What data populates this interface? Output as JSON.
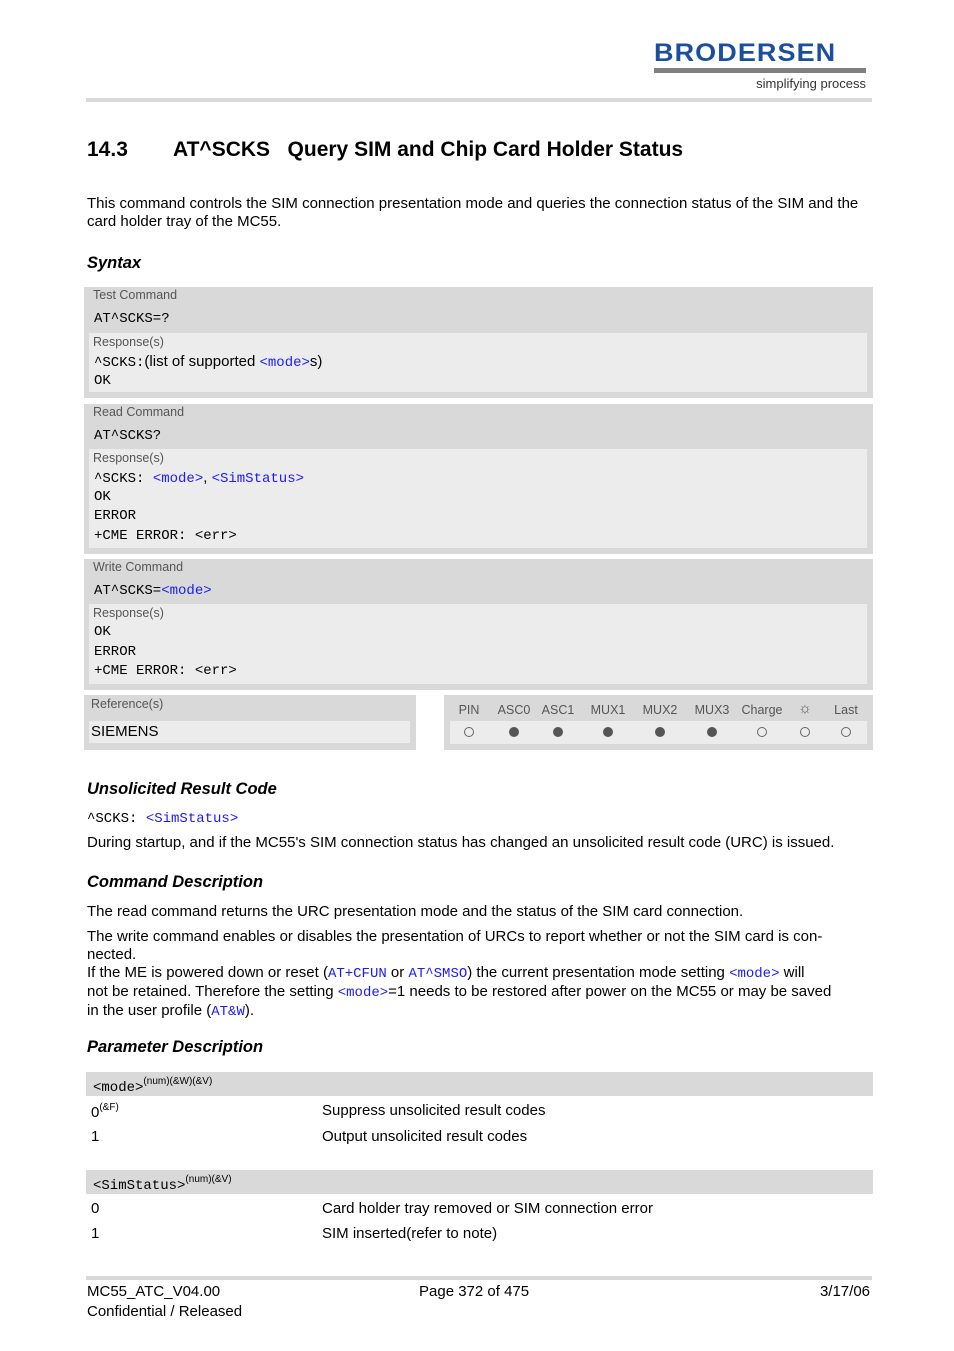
{
  "logo": {
    "brand": "BRODERSEN",
    "tagline": "simplifying process",
    "brand_color": "#1b4f9c"
  },
  "title": {
    "number": "14.3",
    "text": "AT^SCKS   Query SIM and Chip Card Holder Status"
  },
  "intro": "This command controls the SIM connection presentation mode and queries the connection status of the SIM and the card holder tray of the MC55.",
  "sections": {
    "syntax": "Syntax",
    "urc": "Unsolicited Result Code",
    "command_description": "Command Description",
    "parameter_description": "Parameter Description"
  },
  "syntax": {
    "test": {
      "label": "Test Command",
      "command": "AT^SCKS=?",
      "response_label": "Response(s)",
      "resp_prefix": "^SCKS:",
      "resp_text1": "(list of supported ",
      "resp_link": "<mode>",
      "resp_text2": "s)",
      "resp_ok": "OK"
    },
    "read": {
      "label": "Read Command",
      "command": "AT^SCKS?",
      "response_label": "Response(s)",
      "resp_prefix": "^SCKS: ",
      "resp_link1": "<mode>",
      "resp_sep": ", ",
      "resp_link2": "<SimStatus>",
      "lines": [
        "OK",
        "ERROR",
        "+CME ERROR: <err>"
      ]
    },
    "write": {
      "label": "Write Command",
      "command_prefix": "AT^SCKS=",
      "command_link": "<mode>",
      "response_label": "Response(s)",
      "lines": [
        "OK",
        "ERROR",
        "+CME ERROR: <err>"
      ]
    },
    "reference": {
      "label": "Reference(s)",
      "value": "SIEMENS"
    },
    "pins": [
      {
        "label": "PIN",
        "state": "off"
      },
      {
        "label": "ASC0",
        "state": "on"
      },
      {
        "label": "ASC1",
        "state": "on"
      },
      {
        "label": "MUX1",
        "state": "on"
      },
      {
        "label": "MUX2",
        "state": "on"
      },
      {
        "label": "MUX3",
        "state": "on"
      },
      {
        "label": "Charge",
        "state": "off"
      },
      {
        "label": "alarm-icon",
        "state": "off",
        "icon": "☼"
      },
      {
        "label": "Last",
        "state": "off"
      }
    ]
  },
  "urc": {
    "prefix": "^SCKS: ",
    "link": "<SimStatus>",
    "text": "During startup, and if the MC55's SIM connection status has changed an unsolicited result code (URC) is issued."
  },
  "command_description": {
    "p1": "The read command returns the URC presentation mode and the status of the SIM card connection.",
    "p2a": "The write command enables or disables the presentation of URCs to report whether or not the SIM card is con-",
    "p2b": "nected.",
    "p3_1": "If the ME is powered down or reset (",
    "p3_link1": "AT+CFUN",
    "p3_2": " or ",
    "p3_link2": "AT^SMSO",
    "p3_3": ") the current presentation mode setting ",
    "p3_link3": "<mode>",
    "p3_4": " will",
    "p4_1": "not be retained. Therefore the setting ",
    "p4_link": "<mode>",
    "p4_2": "=1 needs to be restored after power on the MC55 or may be saved",
    "p5_1": "in the user profile (",
    "p5_link": "AT&W",
    "p5_2": ")."
  },
  "parameters": [
    {
      "name": "<mode>",
      "attrs": "(num)(&W)(&V)",
      "values": [
        {
          "value": "0",
          "sup": "(&F)",
          "desc": "Suppress unsolicited result codes"
        },
        {
          "value": "1",
          "sup": "",
          "desc": "Output unsolicited result codes"
        }
      ]
    },
    {
      "name": "<SimStatus>",
      "attrs": "(num)(&V)",
      "values": [
        {
          "value": "0",
          "sup": "",
          "desc": "Card holder tray removed or SIM connection error"
        },
        {
          "value": "1",
          "sup": "",
          "desc": "SIM inserted(refer to note)"
        }
      ]
    }
  ],
  "footer": {
    "doc": "MC55_ATC_V04.00",
    "status": "Confidential / Released",
    "page": "Page 372 of 475",
    "date": "3/17/06"
  }
}
